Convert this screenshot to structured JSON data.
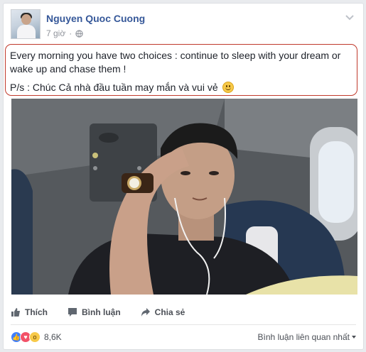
{
  "post": {
    "author": "Nguyen Quoc Cuong",
    "time": "7 giờ",
    "privacy_icon": "globe-icon",
    "menu_icon": "chevron-down-icon",
    "text_line1": "Every morning you have two choices : continue to sleep with your dream or wake up and chase them !",
    "text_line2": "P/s : Chúc Cả nhà đầu tuần may mắn và vui vẻ",
    "highlight_color": "#c0392b"
  },
  "actions": {
    "like": "Thích",
    "comment": "Bình luận",
    "share": "Chia sẻ"
  },
  "reactions": {
    "types": [
      "like",
      "love",
      "wow"
    ],
    "count": "8,6K"
  },
  "comments_sort": "Bình luận liên quan nhất",
  "colors": {
    "link": "#365899",
    "like_blue": "#4080ff",
    "love_red": "#f25268",
    "wow_yellow": "#f7c948"
  }
}
